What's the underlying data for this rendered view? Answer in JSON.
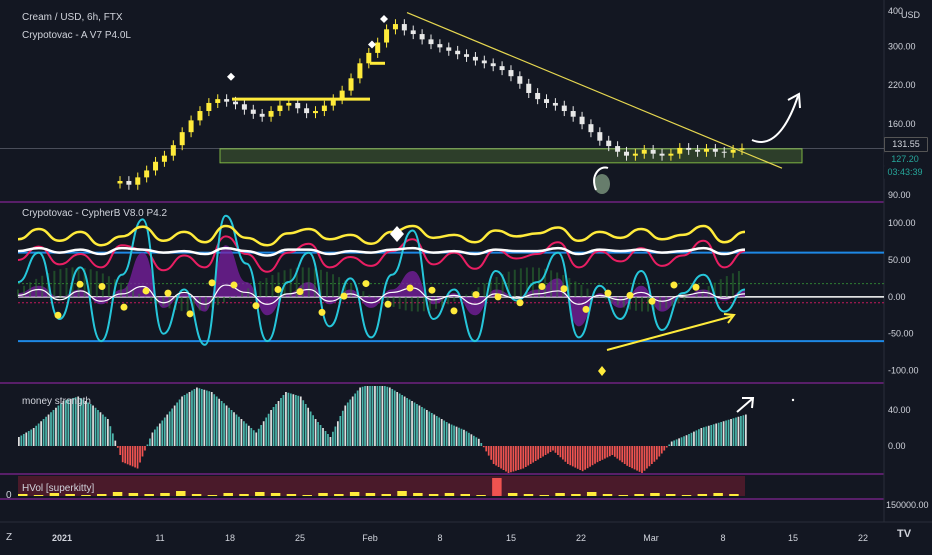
{
  "price_pane": {
    "title": "Cream / USD, 6h, FTX",
    "indicator": "Crypotovac - A V7 P4.0L",
    "currency": "USD",
    "price_tags": [
      {
        "value": "131.55",
        "color": "#131722",
        "text_color": "#d1d4dc"
      },
      {
        "value": "127.20",
        "color": "#131722",
        "text_color": "#26a69a"
      },
      {
        "value": "03:43:39",
        "color": "#131722",
        "text_color": "#26a69a"
      }
    ]
  },
  "osc_pane": {
    "title": "Crypotovac - CypherB V8.0 P4.2"
  },
  "money_pane": {
    "title": "money strength"
  },
  "hvol_pane": {
    "title": "HVol [superkitty]",
    "left_value": "0"
  },
  "bottom_left": "Z",
  "brand": "TV",
  "colors": {
    "background": "#131722",
    "pane_border": "#9c27b0",
    "up_candle": "#ffeb3b",
    "down_candle": "#e8e8e8",
    "trendline": "#e6d750",
    "support_box": "#7cb342",
    "osc_white": "#ffffff",
    "osc_yellow": "#ffeb3b",
    "osc_red": "#e91e63",
    "osc_cyan": "#26c6da",
    "osc_purple": "#7b1fa2",
    "osc_green": "#2e7d32",
    "osc_blue": "#1e88e5",
    "money_green": "#4db6ac",
    "money_white": "#e0e0e0",
    "money_red": "#ef5350"
  },
  "chart_data": [
    {
      "type": "candlestick",
      "title": "Cream / USD, 6h, FTX",
      "yscale": "log",
      "ylim": [
        88,
        410
      ],
      "yticks": [
        "400",
        "300.00",
        "220.00",
        "160.00",
        "90.00"
      ],
      "xticks": [
        "2021",
        "11",
        "18",
        "25",
        "Feb",
        "8",
        "15",
        "22",
        "Mar",
        "8",
        "15",
        "22"
      ],
      "series": [
        {
          "values": [
            101,
            98,
            104,
            110,
            118,
            124,
            135,
            150,
            165,
            178,
            190,
            196,
            192,
            188,
            180,
            174,
            170,
            178,
            186,
            190,
            182,
            175,
            178,
            186,
            196,
            210,
            232,
            262,
            285,
            310,
            345,
            360,
            342,
            332,
            318,
            306,
            298,
            290,
            282,
            276,
            268,
            262,
            256,
            248,
            236,
            222,
            206,
            196,
            190,
            186,
            178,
            170,
            160,
            150,
            140,
            134,
            128,
            124,
            126,
            130,
            126,
            124,
            126,
            132,
            130,
            128,
            131,
            128,
            127,
            130,
            131.55
          ]
        }
      ]
    },
    {
      "type": "line",
      "title": "Crypotovac - CypherB V8.0 P4.2",
      "ylim": [
        -110,
        115
      ],
      "yticks": [
        "100.00",
        "50.00",
        "0.00",
        "-50.00",
        "-100.00"
      ],
      "series": [
        {
          "values": [
            78,
            92,
            76,
            88,
            70,
            82,
            95,
            76,
            88,
            74,
            96,
            80,
            70,
            86,
            92,
            78,
            84,
            72,
            88,
            96,
            80,
            84,
            74,
            90,
            82,
            86,
            94,
            76,
            88,
            80,
            92,
            78,
            84,
            96,
            74,
            88
          ]
        },
        {
          "values": [
            62,
            66,
            60,
            64,
            58,
            66,
            64,
            60,
            62,
            58,
            66,
            62,
            56,
            64,
            64,
            58,
            62,
            60,
            64,
            66,
            60,
            62,
            58,
            64,
            62,
            62,
            66,
            58,
            64,
            62,
            64,
            60,
            62,
            66,
            58,
            64
          ]
        },
        {
          "values": [
            50,
            68,
            44,
            58,
            40,
            70,
            64,
            36,
            56,
            40,
            82,
            58,
            34,
            60,
            72,
            40,
            54,
            42,
            62,
            78,
            44,
            60,
            38,
            64,
            52,
            58,
            74,
            40,
            62,
            48,
            66,
            42,
            56,
            76,
            40,
            62
          ]
        },
        {
          "values": [
            20,
            60,
            -30,
            40,
            -60,
            30,
            105,
            -50,
            10,
            -65,
            110,
            45,
            -60,
            20,
            60,
            -40,
            25,
            -55,
            30,
            90,
            -30,
            10,
            -60,
            35,
            -5,
            20,
            60,
            -55,
            15,
            -30,
            35,
            -45,
            5,
            30,
            -20,
            10
          ]
        },
        {
          "values": [
            2,
            10,
            -4,
            8,
            -6,
            4,
            14,
            -8,
            6,
            -10,
            16,
            6,
            -10,
            4,
            10,
            -6,
            4,
            -8,
            6,
            12,
            -4,
            2,
            -10,
            4,
            -2,
            4,
            8,
            -10,
            2,
            -4,
            6,
            -6,
            2,
            6,
            -2,
            4
          ]
        },
        {
          "values": [
            5,
            15,
            0,
            10,
            -10,
            10,
            60,
            -15,
            5,
            -20,
            70,
            20,
            -25,
            5,
            20,
            -10,
            10,
            -15,
            10,
            35,
            -10,
            5,
            -25,
            10,
            0,
            10,
            25,
            -40,
            5,
            -15,
            15,
            -20,
            0,
            10,
            -5,
            10
          ]
        }
      ],
      "reference_lines": [
        60,
        0,
        -60
      ]
    },
    {
      "type": "bar",
      "title": "money strength",
      "yticks": [
        "40.00",
        "0.00"
      ],
      "values": [
        10,
        20,
        35,
        50,
        55,
        45,
        30,
        -18,
        -25,
        15,
        35,
        55,
        65,
        60,
        45,
        30,
        15,
        40,
        60,
        55,
        30,
        10,
        45,
        65,
        70,
        65,
        55,
        45,
        35,
        25,
        18,
        8,
        -20,
        -30,
        -25,
        -15,
        -5,
        -20,
        -28,
        -18,
        -10,
        -22,
        -30,
        -15,
        5,
        12,
        20,
        25,
        30,
        35
      ]
    },
    {
      "type": "bar",
      "title": "HVol [superkitty]",
      "yticks": [
        "150000.00"
      ],
      "values": [
        2,
        1,
        3,
        2,
        1,
        2,
        4,
        3,
        2,
        3,
        5,
        2,
        1,
        3,
        2,
        4,
        3,
        2,
        1,
        3,
        2,
        4,
        3,
        2,
        5,
        3,
        2,
        3,
        2,
        1,
        18,
        3,
        2,
        1,
        3,
        2,
        4,
        2,
        1,
        2,
        3,
        2,
        1,
        2,
        3,
        2
      ]
    }
  ]
}
